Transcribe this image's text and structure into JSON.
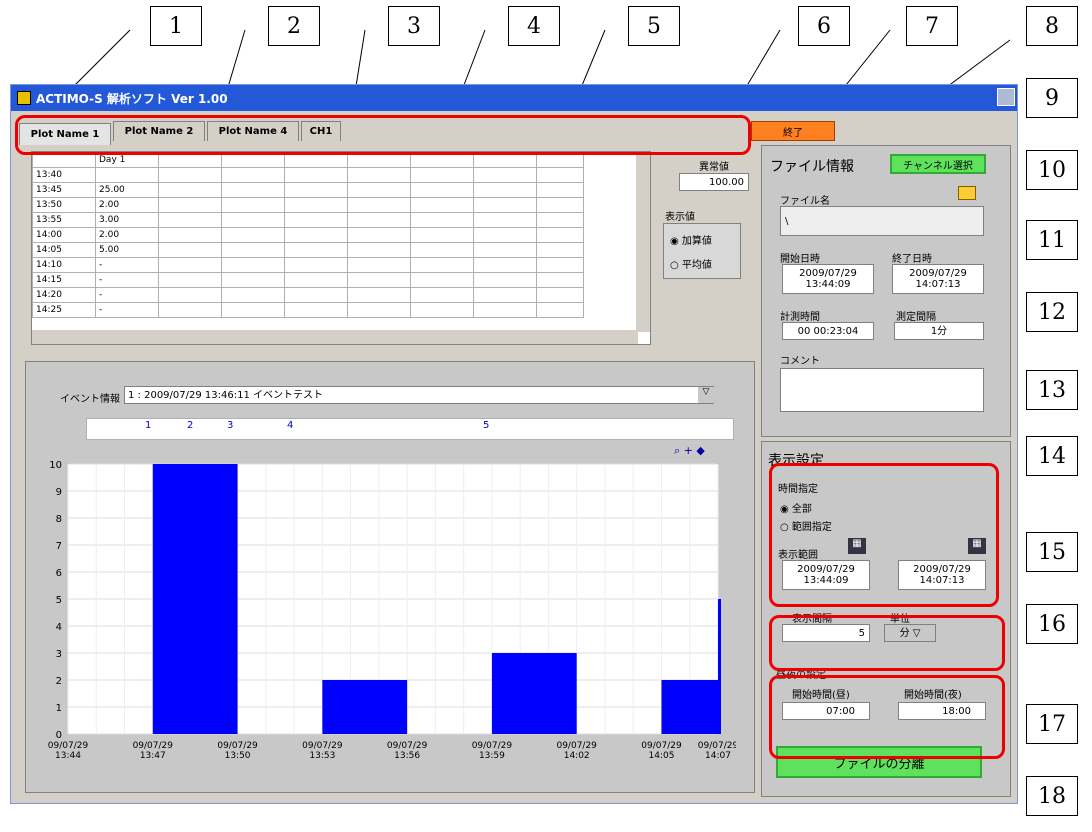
{
  "callouts": [
    "1",
    "2",
    "3",
    "4",
    "5",
    "6",
    "7",
    "8",
    "9",
    "10",
    "11",
    "12",
    "13",
    "14",
    "15",
    "16",
    "17",
    "18"
  ],
  "app": {
    "title": "ACTIMO-S 解析ソフト Ver 1.00",
    "close_label": "終了"
  },
  "tabs": [
    "Plot Name 1",
    "Plot Name 2",
    "Plot Name 4",
    "CH1"
  ],
  "table": {
    "header": [
      "",
      "Day 1"
    ],
    "rows": [
      [
        "13:40",
        ""
      ],
      [
        "13:45",
        "25.00"
      ],
      [
        "13:50",
        "2.00"
      ],
      [
        "13:55",
        "3.00"
      ],
      [
        "14:00",
        "2.00"
      ],
      [
        "14:05",
        "5.00"
      ],
      [
        "14:10",
        "-"
      ],
      [
        "14:15",
        "-"
      ],
      [
        "14:20",
        "-"
      ],
      [
        "14:25",
        "-"
      ]
    ]
  },
  "abnormal": {
    "label": "異常値",
    "value": "100.00"
  },
  "display_value": {
    "label": "表示値",
    "options": [
      "加算値",
      "平均値"
    ],
    "selected": 0
  },
  "event": {
    "label": "イベント情報",
    "value": "1 : 2009/07/29 13:46:11 イベントテスト",
    "markers": [
      "1",
      "2",
      "3",
      "4",
      "5"
    ]
  },
  "file_info": {
    "title": "ファイル情報",
    "channel_button": "チャンネル選択",
    "filename_label": "ファイル名",
    "filename_value": "\\",
    "start_label": "開始日時",
    "start_value": "2009/07/29 13:44:09",
    "end_label": "終了日時",
    "end_value": "2009/07/29 14:07:13",
    "duration_label": "計測時間",
    "duration_value": "00 00:23:04",
    "interval_label": "測定間隔",
    "interval_value": "1分",
    "comment_label": "コメント"
  },
  "display_settings": {
    "title": "表示設定",
    "time_spec_label": "時間指定",
    "options": [
      "全部",
      "範囲指定"
    ],
    "selected": 0,
    "range_label": "表示範囲",
    "range_start": "2009/07/29 13:44:09",
    "range_end": "2009/07/29 14:07:13",
    "interval_label": "表示間隔",
    "interval_value": "5",
    "unit_label": "単位",
    "unit_value": "分"
  },
  "day_night": {
    "title": "昼夜の設定",
    "day_label": "開始時間(昼)",
    "day_value": "07:00",
    "night_label": "開始時間(夜)",
    "night_value": "18:00"
  },
  "separate_button": "ファイルの分離",
  "chart_data": {
    "type": "bar",
    "bars": [
      {
        "start": "13:47",
        "end": "13:50",
        "value": 10
      },
      {
        "start": "13:53",
        "end": "13:56",
        "value": 2
      },
      {
        "start": "13:59",
        "end": "14:02",
        "value": 3
      },
      {
        "start": "14:05",
        "end": "14:07",
        "value": 2
      },
      {
        "start": "14:07",
        "end": "14:07",
        "value": 5
      }
    ],
    "ylim": [
      0,
      10
    ],
    "yticks": [
      "0",
      "1",
      "2",
      "3",
      "4",
      "5",
      "6",
      "7",
      "8",
      "9",
      "10"
    ],
    "xticks": [
      "09/07/29 13:44",
      "09/07/29 13:47",
      "09/07/29 13:50",
      "09/07/29 13:53",
      "09/07/29 13:56",
      "09/07/29 13:59",
      "09/07/29 14:02",
      "09/07/29 14:05",
      "09/07/29 14:07"
    ],
    "bar_color": "#0000ff",
    "grid": true
  }
}
